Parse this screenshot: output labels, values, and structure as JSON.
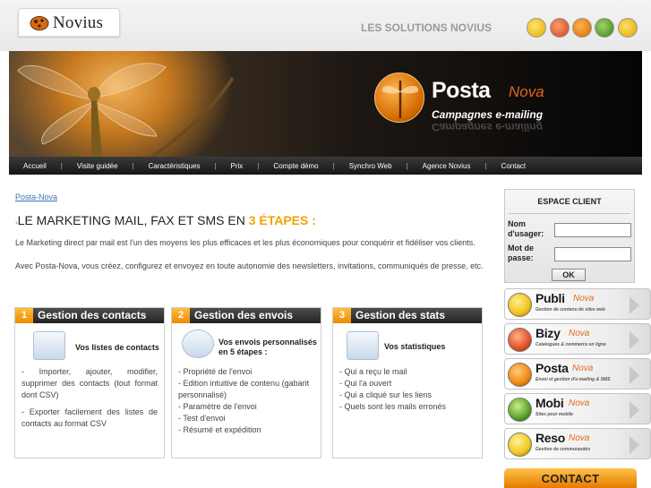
{
  "header": {
    "logo_text": "Novius",
    "solutions_label": "LES SOLUTIONS NOVIUS",
    "product_icons": [
      "publi-icon",
      "bizy-icon",
      "posta-icon",
      "mobi-icon",
      "reso-icon"
    ]
  },
  "banner": {
    "brand_name": "Posta",
    "brand_nova": "Nova",
    "tagline": "Campagnes e-mailing"
  },
  "nav": {
    "items": [
      "Accueil",
      "Visite guidée",
      "Caractéristiques",
      "Prix",
      "Compte démo",
      "Synchro Web",
      "Agence Novius",
      "Contact"
    ]
  },
  "breadcrumb": "Posta-Nova",
  "headline": {
    "bullet": "›",
    "text": "LE MARKETING MAIL, FAX ET SMS EN ",
    "highlight": "3 ÉTAPES :"
  },
  "intro": {
    "p1": "Le Marketing direct par mail est l'un des moyens les plus efficaces et les plus économiques pour conquérir et fidéliser vos clients.",
    "p2": "Avec Posta-Nova, vous créez, configurez et envoyez en toute autonomie des newsletters, invitations, communiqués de presse, etc."
  },
  "steps": [
    {
      "number": "1",
      "title": "Gestion des contacts",
      "subtitle": "Vos listes de contacts",
      "items": [
        "- Importer, ajouter, modifier, supprimer des contacts (tout format dont CSV)",
        "- Exporter facilement des listes de contacts au format CSV"
      ]
    },
    {
      "number": "2",
      "title": "Gestion des envois",
      "subtitle": "Vos envois personnalisés en 5 étapes :",
      "items": [
        "- Propriété de l'envoi",
        "- Edition intuitive de contenu (gabarit personnalisé)",
        "- Paramètre de l'envoi",
        "- Test d'envoi",
        "- Résumé et expédition"
      ]
    },
    {
      "number": "3",
      "title": "Gestion des stats",
      "subtitle": "Vos statistiques",
      "items": [
        "- Qui a reçu le mail",
        "- Qui l'a ouvert",
        "- Qui a cliqué sur les liens",
        "- Quels sont les mails erronés"
      ]
    }
  ],
  "client": {
    "title": "ESPACE CLIENT",
    "user_label": "Nom d'usager:",
    "user_value": "",
    "pass_label": "Mot de passe:",
    "pass_value": "",
    "ok_label": "OK"
  },
  "products": [
    {
      "name": "Publi",
      "nova": "Nova",
      "desc": "Gestion de contenu de sites web",
      "color": "#f0c21a"
    },
    {
      "name": "Bizy",
      "nova": "Nova",
      "desc": "Catalogues & commerce en ligne",
      "color": "#e0522a"
    },
    {
      "name": "Posta",
      "nova": "Nova",
      "desc": "Envoi et gestion d'e-mailing & SMS",
      "color": "#ee8a10"
    },
    {
      "name": "Mobi",
      "nova": "Nova",
      "desc": "Sites pour mobile",
      "color": "#5aa02c"
    },
    {
      "name": "Reso",
      "nova": "Nova",
      "desc": "Gestion de communautés",
      "color": "#f3c81e"
    }
  ],
  "contact_button": "CONTACT"
}
